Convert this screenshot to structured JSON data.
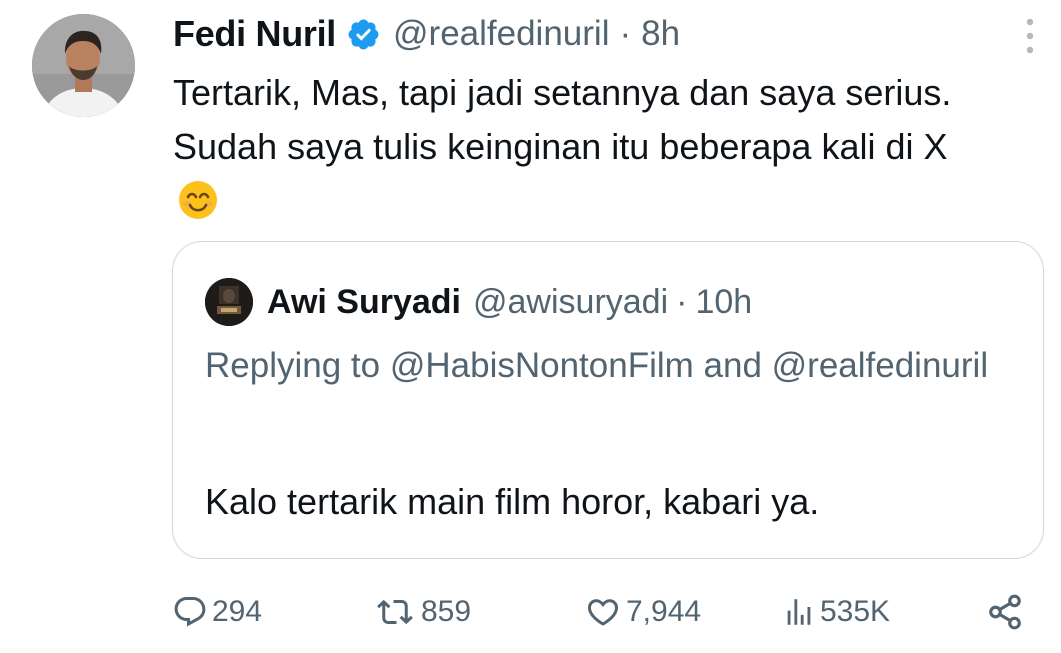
{
  "tweet": {
    "author_name": "Fedi Nuril",
    "handle": "@realfedinuril",
    "separator": "·",
    "time": "8h",
    "text": "Tertarik, Mas, tapi jadi setannya dan saya serius. Sudah saya tulis keinginan itu beberapa kali di X",
    "emoji": "smiling-face-with-smiling-eyes"
  },
  "quote": {
    "author_name": "Awi Suryadi",
    "handle": "@awisuryadi",
    "separator": "·",
    "time": "10h",
    "replying_to": "Replying to @HabisNontonFilm and @realfedinuril",
    "text": "Kalo tertarik main film horor, kabari ya."
  },
  "actions": {
    "replies": "294",
    "reposts": "859",
    "likes": "7,944",
    "views": "535K"
  },
  "icons": {
    "verified": "verified-badge-icon",
    "more": "more-vertical-icon",
    "reply": "reply-icon",
    "repost": "repost-icon",
    "like": "heart-icon",
    "views": "views-icon",
    "share": "share-icon"
  },
  "colors": {
    "text": "#0f1419",
    "secondary": "#536471",
    "verified_blue": "#1d9bf0",
    "border": "#cfd9de"
  }
}
